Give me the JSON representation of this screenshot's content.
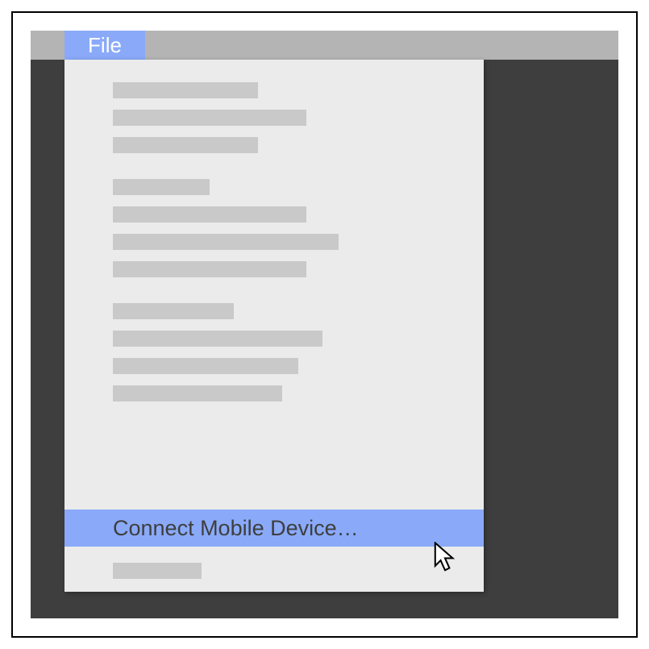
{
  "menubar": {
    "file_label": "File"
  },
  "dropdown": {
    "highlighted_label": "Connect Mobile Device…",
    "groups": [
      [
        180,
        240,
        180
      ],
      [
        120,
        240,
        280,
        240
      ],
      [
        150,
        260,
        230,
        210
      ]
    ],
    "after_width": 110
  }
}
